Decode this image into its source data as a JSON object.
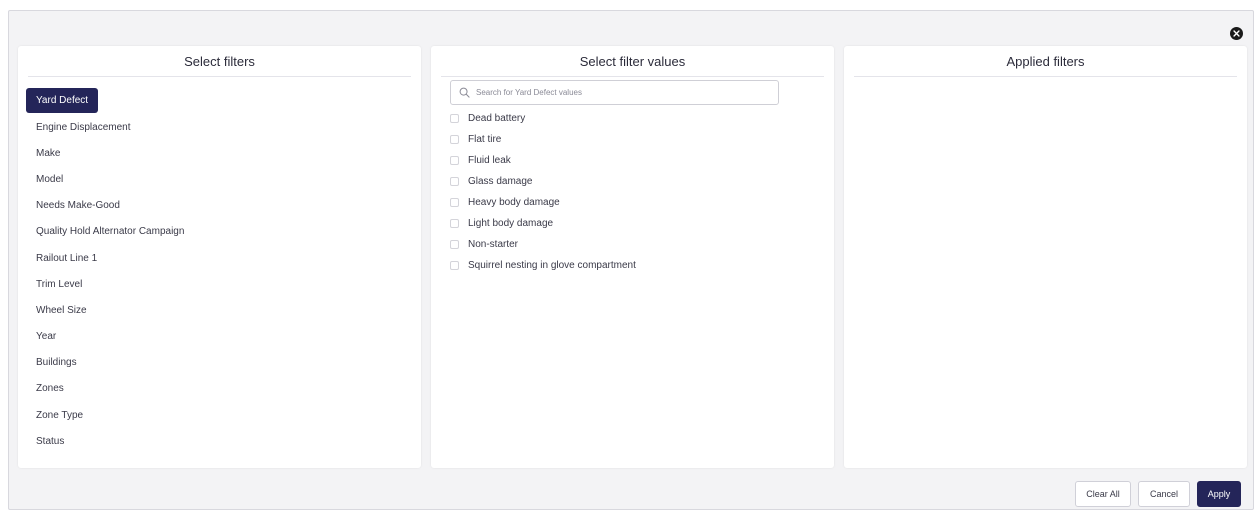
{
  "colors": {
    "accent": "#242559",
    "panel_bg": "#ffffff",
    "modal_bg": "#f3f3f5"
  },
  "close": {
    "icon": "close-icon"
  },
  "select_filters": {
    "title": "Select filters",
    "items": [
      {
        "label": "Yard Defect",
        "active": true
      },
      {
        "label": "Engine Displacement"
      },
      {
        "label": "Make"
      },
      {
        "label": "Model"
      },
      {
        "label": "Needs Make-Good"
      },
      {
        "label": "Quality Hold Alternator Campaign"
      },
      {
        "label": "Railout Line 1"
      },
      {
        "label": "Trim Level"
      },
      {
        "label": "Wheel Size"
      },
      {
        "label": "Year"
      },
      {
        "label": "Buildings"
      },
      {
        "label": "Zones"
      },
      {
        "label": "Zone Type"
      },
      {
        "label": "Status"
      }
    ]
  },
  "filter_values": {
    "title": "Select filter values",
    "search": {
      "placeholder": "Search for Yard Defect values",
      "value": "",
      "icon": "search-icon"
    },
    "items": [
      {
        "label": "Dead battery",
        "checked": false
      },
      {
        "label": "Flat tire",
        "checked": false
      },
      {
        "label": "Fluid leak",
        "checked": false
      },
      {
        "label": "Glass damage",
        "checked": false
      },
      {
        "label": "Heavy body damage",
        "checked": false
      },
      {
        "label": "Light body damage",
        "checked": false
      },
      {
        "label": "Non-starter",
        "checked": false
      },
      {
        "label": "Squirrel nesting in glove compartment",
        "checked": false
      }
    ]
  },
  "applied_filters": {
    "title": "Applied filters"
  },
  "footer": {
    "clear_label": "Clear All",
    "cancel_label": "Cancel",
    "apply_label": "Apply"
  }
}
